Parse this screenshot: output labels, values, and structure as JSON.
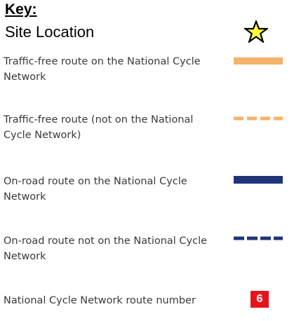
{
  "key": {
    "title": "Key:",
    "site_location_label": "Site Location"
  },
  "colors": {
    "orange": "#f4b26a",
    "blue": "#1f3578",
    "red": "#e8141c",
    "star_fill": "#ffff33",
    "star_stroke": "#000000"
  },
  "items": [
    {
      "label": "Traffic-free route on the National Cycle Network",
      "symbol": "solid-orange-line"
    },
    {
      "label": "Traffic-free route (not on the National Cycle Network)",
      "symbol": "dashed-orange-line"
    },
    {
      "label": "On-road route on the National Cycle Network",
      "symbol": "solid-blue-line"
    },
    {
      "label": "On-road route not on the National Cycle Network",
      "symbol": "dashed-blue-line"
    },
    {
      "label": "National Cycle Network route number",
      "symbol": "red-route-badge",
      "badge_number": "6"
    }
  ],
  "icons": {
    "site_location": "star-icon"
  }
}
